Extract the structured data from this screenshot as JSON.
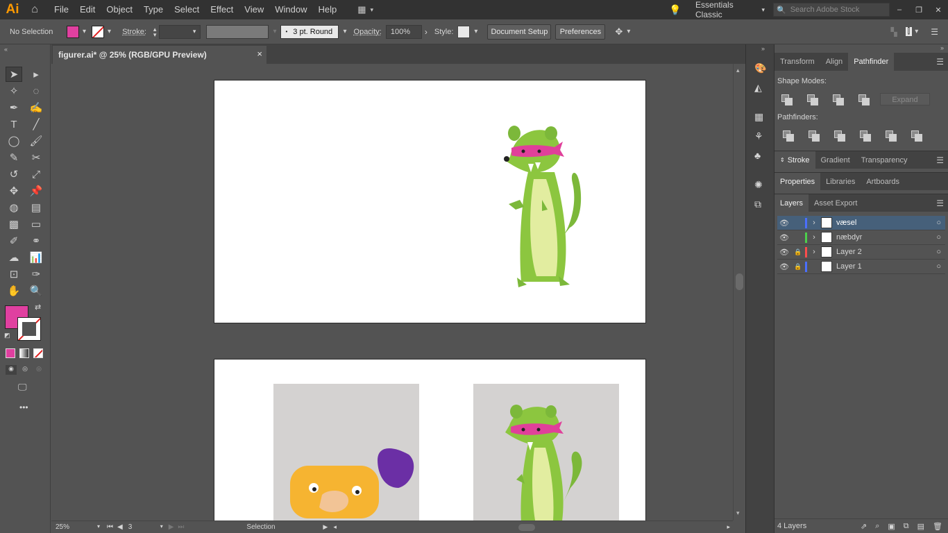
{
  "app": {
    "logo": "Ai",
    "workspace": "Essentials Classic",
    "search_placeholder": "Search Adobe Stock"
  },
  "menu": [
    "File",
    "Edit",
    "Object",
    "Type",
    "Select",
    "Effect",
    "View",
    "Window",
    "Help"
  ],
  "control": {
    "selection": "No Selection",
    "stroke_label": "Stroke:",
    "brush": "3 pt. Round",
    "opacity_label": "Opacity:",
    "opacity_value": "100%",
    "style_label": "Style:",
    "document_setup": "Document Setup",
    "preferences": "Preferences"
  },
  "document": {
    "tab_title": "figurer.ai* @ 25% (RGB/GPU Preview)",
    "close": "×"
  },
  "status": {
    "zoom": "25%",
    "artboard": "3",
    "mode": "Selection"
  },
  "panels": {
    "top_tabs": [
      "Transform",
      "Align",
      "Pathfinder"
    ],
    "shape_modes_label": "Shape Modes:",
    "expand_label": "Expand",
    "pathfinders_label": "Pathfinders:",
    "stroke_tabs": [
      "Stroke",
      "Gradient",
      "Transparency"
    ],
    "prop_tabs": [
      "Properties",
      "Libraries",
      "Artboards"
    ],
    "layers_tabs": [
      "Layers",
      "Asset Export"
    ],
    "layers": [
      {
        "name": "væsel",
        "color": "#4a6fff",
        "locked": false,
        "expandable": true
      },
      {
        "name": "næbdyr",
        "color": "#4ccf4c",
        "locked": false,
        "expandable": true
      },
      {
        "name": "Layer 2",
        "color": "#ff4d4d",
        "locked": true,
        "expandable": true
      },
      {
        "name": "Layer 1",
        "color": "#4a6fff",
        "locked": true,
        "expandable": false
      }
    ],
    "layers_count": "4 Layers"
  },
  "colors": {
    "fill": "#e040a0",
    "accent_weasel": "#7cc23a",
    "mask": "#e0409a",
    "platypus": "#f6b431",
    "platypus_tail": "#6b2fa5"
  }
}
